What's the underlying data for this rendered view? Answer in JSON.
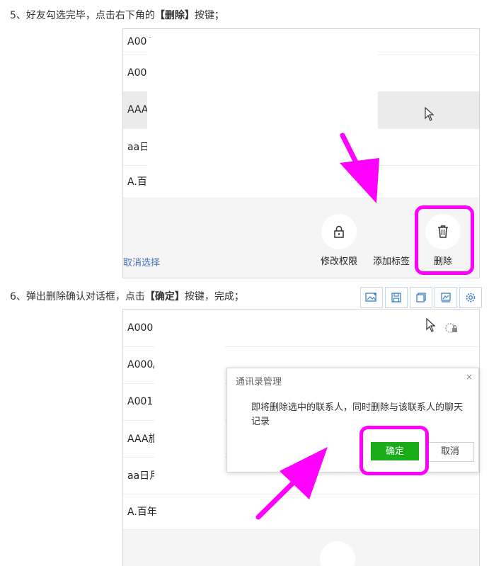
{
  "step5": {
    "number": "5、",
    "text_before": "好友勾选完毕，点击右下角的",
    "bold": "【删除】",
    "text_after": "按键；"
  },
  "panel1": {
    "rows": [
      "A000",
      "A00",
      "AAA",
      "aa日",
      "A.百"
    ],
    "cancel_selection": "取消选择",
    "actions": [
      {
        "label": "修改权限",
        "icon": "lock-icon"
      },
      {
        "label": "添加标签",
        "icon": "tag-icon"
      },
      {
        "label": "删除",
        "icon": "trash-icon"
      }
    ],
    "row_selected_color": "#ebebeb"
  },
  "step6": {
    "number": "6、",
    "text_before": "弹出删除确认对话框，点击",
    "bold": "【确定】",
    "text_after": "按键，完成；"
  },
  "toolbar": {
    "icons": [
      "image-edit-icon",
      "save-icon",
      "copy-icon",
      "picture-icon",
      "settings-icon"
    ]
  },
  "panel2": {
    "rows": [
      "A000",
      "A000/",
      "A001",
      "AAA旅",
      "aa日月",
      "A.百年"
    ]
  },
  "dialog": {
    "title": "通讯录管理",
    "close": "×",
    "message": "即将删除选中的联系人，同时删除与该联系人的聊天记录",
    "ok": "确定",
    "cancel": "取消"
  },
  "colors": {
    "highlight": "#ff00ff",
    "ok_button": "#1aad19",
    "link": "#4a73b8"
  }
}
